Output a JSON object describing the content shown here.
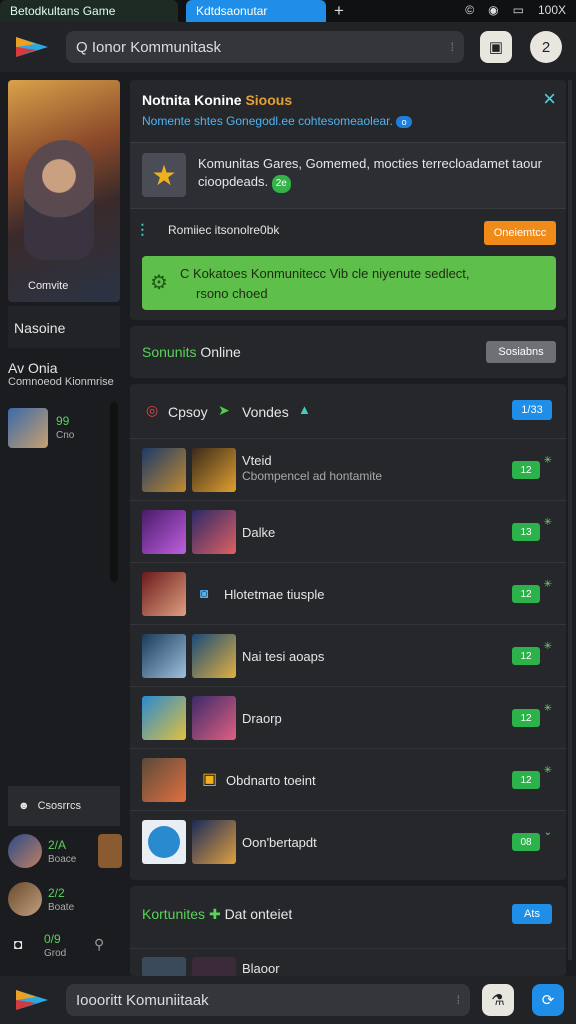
{
  "tabs": [
    {
      "label": "Betodkultans Game"
    },
    {
      "label": "Kdtdsaonutar"
    }
  ],
  "system": {
    "time": "100X",
    "icons": [
      "copyright-icon",
      "wifi-icon",
      "battery-icon"
    ]
  },
  "toolbar": {
    "search_placeholder": "Q Ionor Kommunitask",
    "right_btn1_icon": "screen-icon",
    "right_btn2_label": "2"
  },
  "sidebar": {
    "hero_label": "Comvite",
    "title": "Nasoine",
    "sub1": "Av Onia",
    "sub2": "Comnoeod Kionmrise",
    "games": [
      {
        "num": "99",
        "sub": "Cno"
      }
    ],
    "bar_label": "Csosrrcs",
    "bottom_games": [
      {
        "num": "2/A",
        "sub": "Boace"
      },
      {
        "num": "2/2",
        "sub": "Boate"
      }
    ],
    "footer_num": "0/9",
    "footer_sub": "Grod"
  },
  "notification": {
    "title_main": "Notnita Konine",
    "title_accent": "Sioous",
    "subtitle": "Nomente shtes Gonegodl.ee cohtesomeaolear.",
    "subtitle_badge": "o",
    "body_text": "Komunitas Gares, Gomemed, mocties terrecloadamet taour cioopdeads.",
    "body_badge": "2e",
    "row2_text": "Romiiec itsonolre0bk",
    "orange_label": "Oneiemtcc",
    "green_line1": "C  Kokatoes Konmunitecc Vib cle niyenute sedlect,",
    "green_line2": "rsono choed"
  },
  "section1": {
    "title_accent": "Sonunits",
    "title_rest": "Online",
    "button_label": "Sosiabns"
  },
  "list": {
    "header": {
      "label1": "Cpsoy",
      "label2": "Vondes",
      "button_label": "1/33"
    },
    "rows": [
      {
        "name": "Vteid",
        "sub": "Cbompencel ad hontamite",
        "badge": "12"
      },
      {
        "name": "Dalke",
        "sub": "",
        "badge": "13"
      },
      {
        "name": "Hlotetmae tiusple",
        "sub": "",
        "badge": "12"
      },
      {
        "name": "Nai tesi aoaps",
        "sub": "",
        "badge": "12"
      },
      {
        "name": "Draorp",
        "sub": "",
        "badge": "12"
      },
      {
        "name": "Obdnarto toeint",
        "sub": "",
        "badge": "12"
      },
      {
        "name": "Oon'bertapdt",
        "sub": "",
        "badge": "08"
      }
    ]
  },
  "section2": {
    "title_accent": "Kortunites",
    "title_rest": "Dat onteiet",
    "button_label": "Ats",
    "row_name": "Blaoor"
  },
  "bottombar": {
    "search_placeholder": "Ioooritt Komuniitaak"
  },
  "colors": {
    "accent_green": "#58d458",
    "accent_blue": "#1e8ee8",
    "orange": "#f08a18"
  }
}
